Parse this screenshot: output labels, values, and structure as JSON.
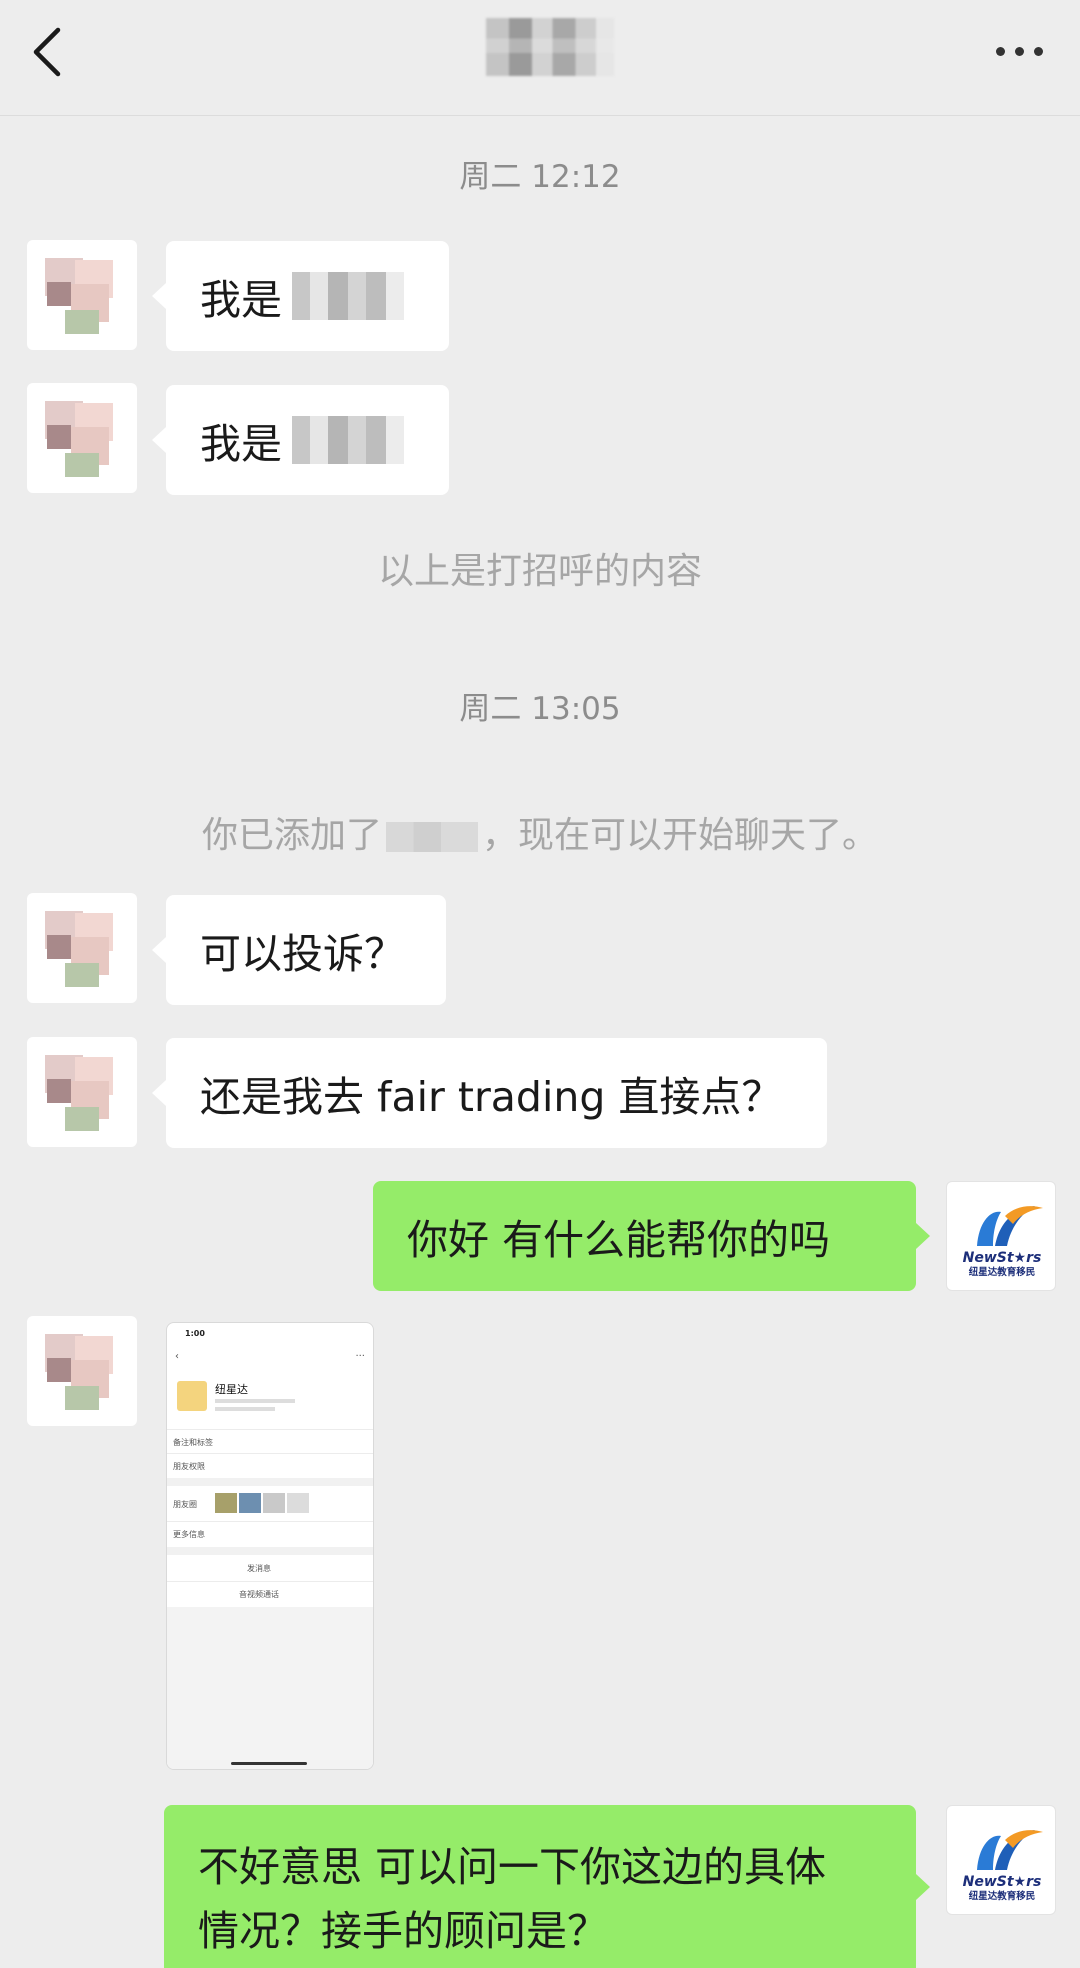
{
  "header": {
    "title": "",
    "back_icon": "chevron-left-icon",
    "more_icon": "more-dots-icon"
  },
  "timestamps": {
    "first": "周二 12:12",
    "second": "周二 13:05"
  },
  "system": {
    "greeting_note": "以上是打招呼的内容",
    "added_prefix": "你已添加了",
    "added_suffix": "，现在可以开始聊天了。"
  },
  "messages": {
    "m1": "我是",
    "m2": "我是",
    "m3": "可以投诉？",
    "m4": "还是我去 fair trading 直接点？",
    "m5": "你好 有什么能帮你的吗",
    "m7_line1": "不好意思 可以问一下你这边的具体",
    "m7_line2": "情况？接手的顾问是？"
  },
  "screenshot_card": {
    "status_time": "1:00",
    "name": "纽星达",
    "row1": "备注和标签",
    "row2": "朋友权限",
    "row3": "朋友圈",
    "row4": "更多信息",
    "btn1": "发消息",
    "btn2": "音视频通话"
  },
  "logo": {
    "brand": "NewSt★rs",
    "cn": "纽星达教育移民"
  },
  "colors": {
    "background": "#ededed",
    "outgoing_bubble": "#95ec69",
    "incoming_bubble": "#ffffff",
    "system_text": "#a6a6a6"
  }
}
